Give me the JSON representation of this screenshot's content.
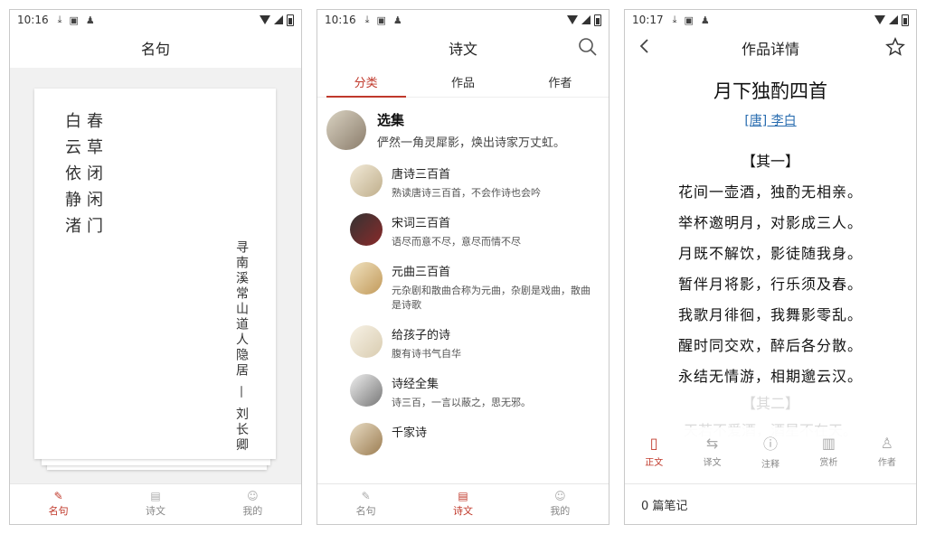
{
  "phone1": {
    "status": {
      "time": "10:16"
    },
    "title": "名句",
    "poem": {
      "col1": "春草闭闲门",
      "col2": "白云依静渚",
      "author": "寻南溪常山道人隐居 — 刘长卿"
    },
    "nav": [
      {
        "label": "名句"
      },
      {
        "label": "诗文"
      },
      {
        "label": "我的"
      }
    ]
  },
  "phone2": {
    "status": {
      "time": "10:16"
    },
    "title": "诗文",
    "tabs": [
      {
        "label": "分类"
      },
      {
        "label": "作品"
      },
      {
        "label": "作者"
      }
    ],
    "header": {
      "title": "选集",
      "subtitle": "俨然一角灵犀影，焕出诗家万丈虹。"
    },
    "items": [
      {
        "title": "唐诗三百首",
        "subtitle": "熟读唐诗三百首，不会作诗也会吟"
      },
      {
        "title": "宋词三百首",
        "subtitle": "语尽而意不尽，意尽而情不尽"
      },
      {
        "title": "元曲三百首",
        "subtitle": "元杂剧和散曲合称为元曲，杂剧是戏曲，散曲是诗歌"
      },
      {
        "title": "给孩子的诗",
        "subtitle": "腹有诗书气自华"
      },
      {
        "title": "诗经全集",
        "subtitle": "诗三百，一言以蔽之，思无邪。"
      },
      {
        "title": "千家诗",
        "subtitle": ""
      }
    ],
    "nav": [
      {
        "label": "名句"
      },
      {
        "label": "诗文"
      },
      {
        "label": "我的"
      }
    ]
  },
  "phone3": {
    "status": {
      "time": "10:17"
    },
    "title": "作品详情",
    "poem_title": "月下独酌四首",
    "author": "[唐] 李白",
    "section": "【其一】",
    "lines": [
      "花间一壶酒，独酌无相亲。",
      "举杯邀明月，对影成三人。",
      "月既不解饮，影徒随我身。",
      "暂伴月将影，行乐须及春。",
      "我歌月徘徊，我舞影零乱。",
      "醒时同交欢，醉后各分散。",
      "永结无情游，相期邈云汉。"
    ],
    "faded_section": "【其二】",
    "faded_line": "天若不爱酒，酒星不在天。",
    "tabs": [
      {
        "label": "正文"
      },
      {
        "label": "译文"
      },
      {
        "label": "注释"
      },
      {
        "label": "赏析"
      },
      {
        "label": "作者"
      }
    ],
    "notes": "0 篇笔记"
  },
  "colors": {
    "accent": "#c0392b",
    "link": "#2a6db0"
  }
}
